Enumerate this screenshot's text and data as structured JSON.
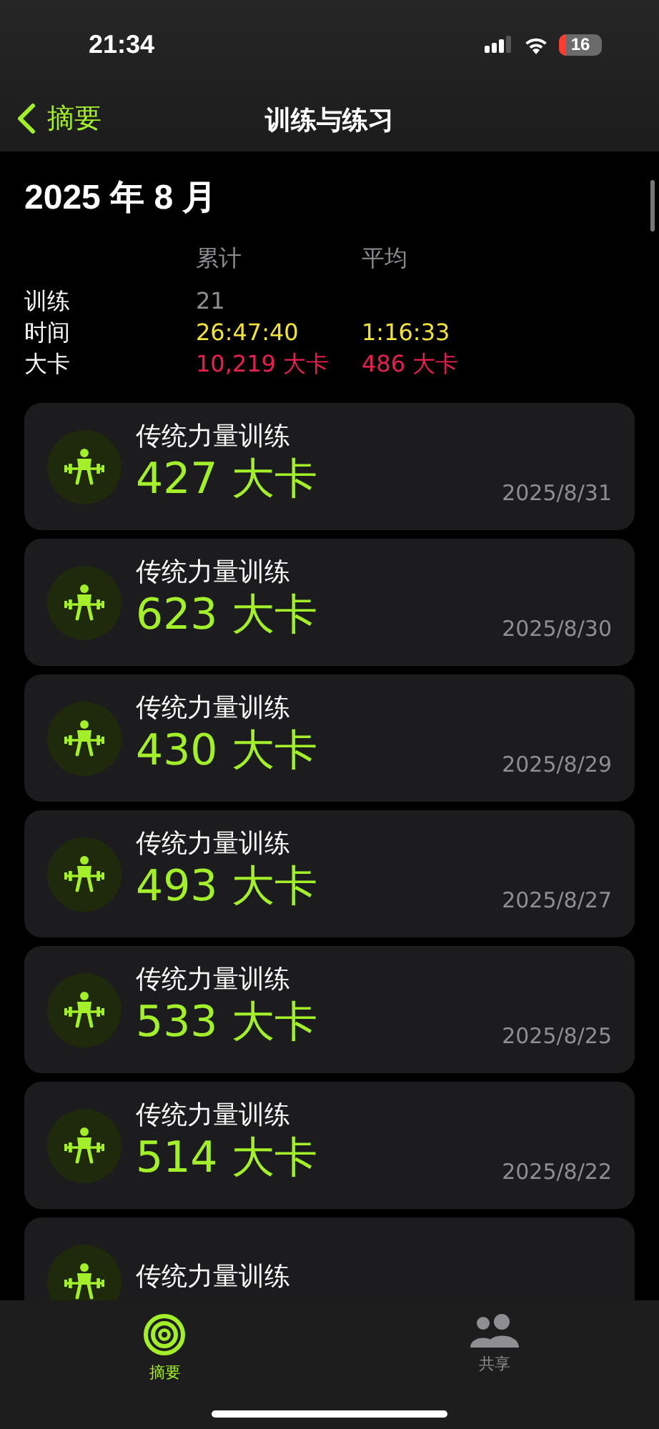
{
  "status_bar": {
    "time": "21:34",
    "battery": "16"
  },
  "nav": {
    "back": "摘要",
    "title": "训练与练习"
  },
  "month": "2025 年 8 月",
  "stats": {
    "headers": [
      "累计",
      "平均"
    ],
    "rows": [
      {
        "label": "训练",
        "values": [
          "21"
        ],
        "color": "#8e8e93"
      },
      {
        "label": "时间",
        "values": [
          "26:47:40",
          "1:16:33"
        ],
        "color": "#f2e33a"
      },
      {
        "label": "大卡",
        "values": [
          "10,219 大卡",
          "486 大卡"
        ],
        "color": "#e8204f"
      }
    ]
  },
  "workouts": [
    {
      "name": "传统力量训练",
      "calories": "427 大卡",
      "date": "2025/8/31"
    },
    {
      "name": "传统力量训练",
      "calories": "623 大卡",
      "date": "2025/8/30"
    },
    {
      "name": "传统力量训练",
      "calories": "430 大卡",
      "date": "2025/8/29"
    },
    {
      "name": "传统力量训练",
      "calories": "493 大卡",
      "date": "2025/8/27"
    },
    {
      "name": "传统力量训练",
      "calories": "533 大卡",
      "date": "2025/8/25"
    },
    {
      "name": "传统力量训练",
      "calories": "514 大卡",
      "date": "2025/8/22"
    },
    {
      "name": "传统力量训练"
    }
  ],
  "tabs": [
    {
      "label": "摘要",
      "kind": "summary",
      "selected": true
    },
    {
      "label": "共享",
      "kind": "sharing",
      "selected": false
    }
  ]
}
